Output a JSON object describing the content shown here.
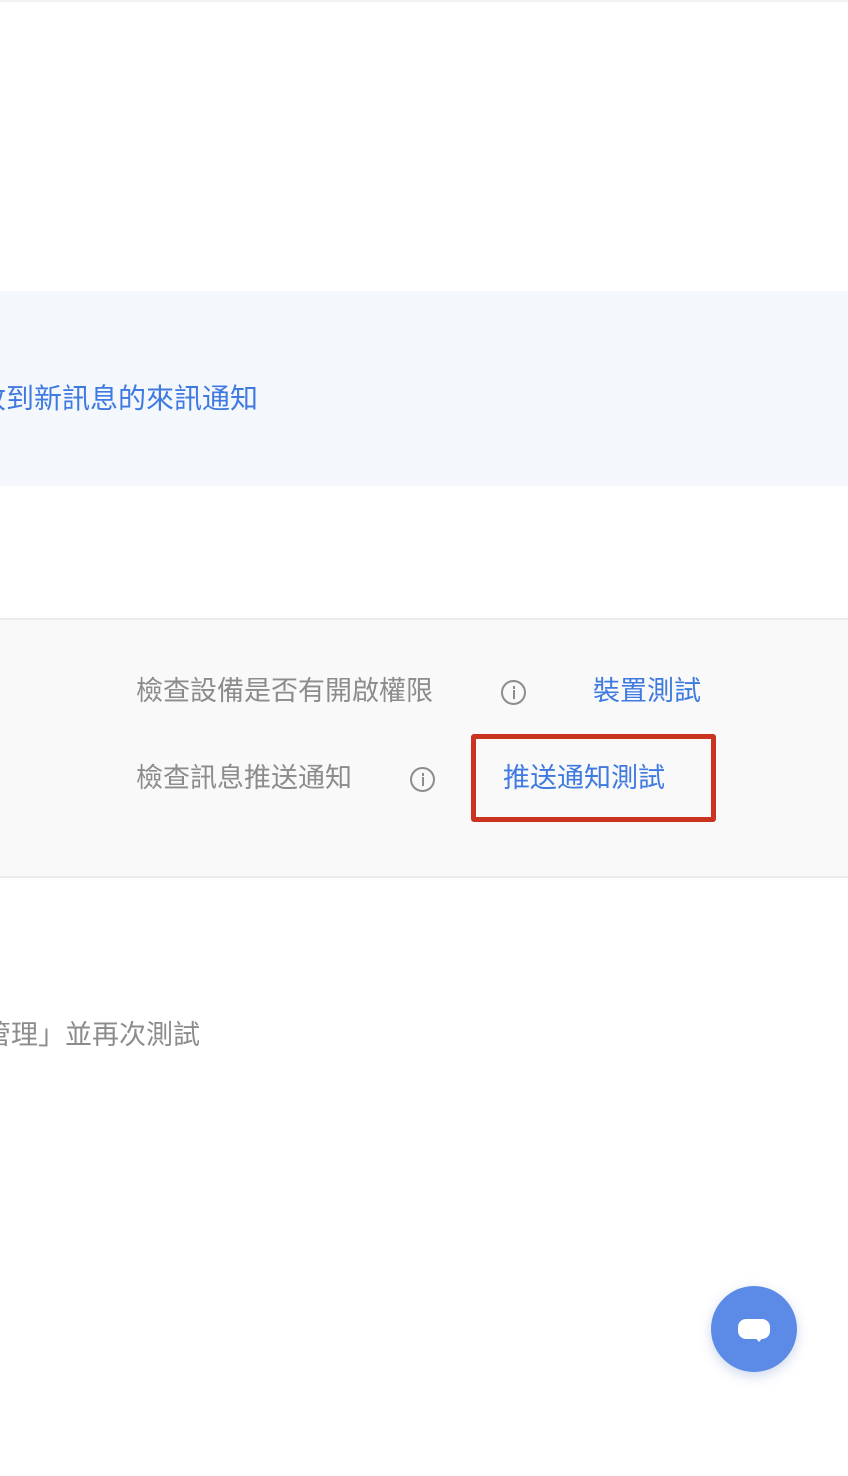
{
  "banner": {
    "text": "收到新訊息的來訊通知"
  },
  "tests": [
    {
      "label": "檢查設備是否有開啟權限",
      "action": "裝置測試"
    },
    {
      "label": "檢查訊息推送通知",
      "action": "推送通知測試"
    }
  ],
  "footer": {
    "text": "管理」並再次測試"
  },
  "colors": {
    "accent": "#3f7ae0",
    "highlight": "#c9331f",
    "fab": "#5b8be6"
  },
  "icons": {
    "info": "info-circle-icon",
    "chat": "chat-bubble-icon"
  }
}
